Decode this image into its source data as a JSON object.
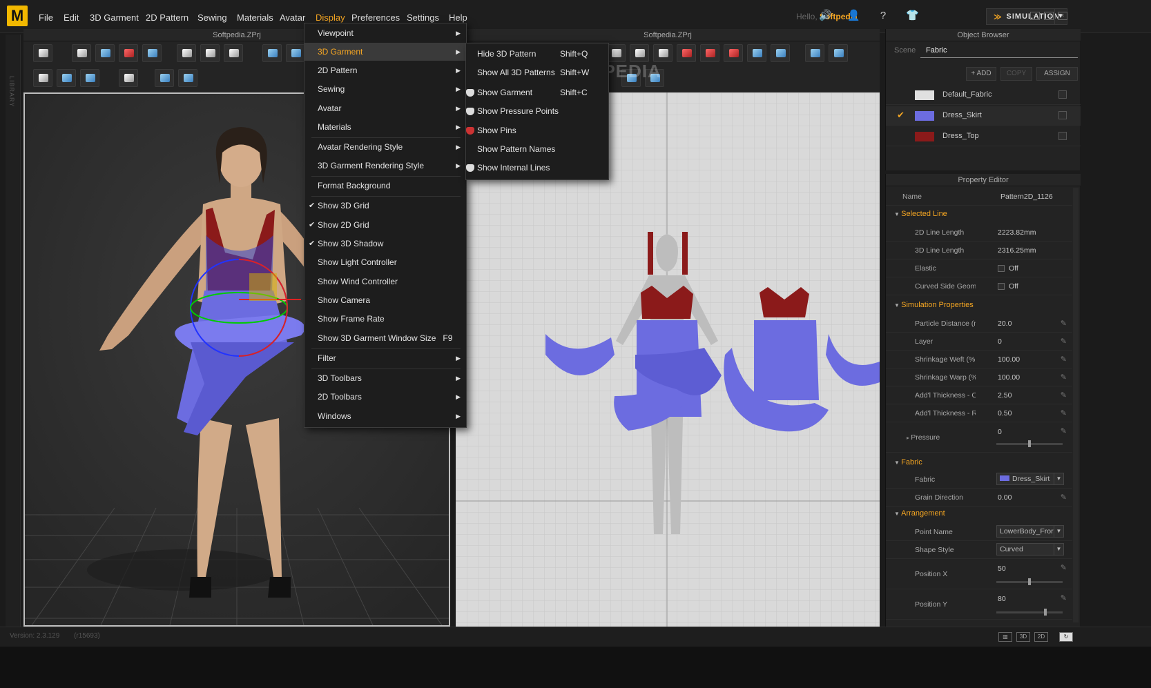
{
  "app": {
    "logo_letter": "M",
    "menus": [
      "File",
      "Edit",
      "3D Garment",
      "2D Pattern",
      "Sewing",
      "Materials",
      "Avatar",
      "Display",
      "Preferences",
      "Settings",
      "Help"
    ],
    "active_menu": "Display",
    "hello_prefix": "Hello,",
    "user": "Softpedia",
    "simulation_label": "SIMULATION",
    "library_label": "LIBRARY"
  },
  "panels": {
    "view3d_title": "Softpedia.ZPrj",
    "view2d_title": "Softpedia.ZPrj",
    "watermark": "SOFTPEDIA"
  },
  "display_menu": {
    "items": [
      {
        "label": "Viewpoint",
        "arrow": "▶"
      },
      {
        "label": "3D Garment",
        "arrow": "▶"
      },
      {
        "label": "2D Pattern",
        "arrow": "▶"
      },
      {
        "label": "Sewing",
        "arrow": "▶"
      },
      {
        "label": "Avatar",
        "arrow": "▶"
      },
      {
        "label": "Materials",
        "arrow": "▶"
      },
      {
        "label": "Avatar Rendering Style",
        "arrow": "▶"
      },
      {
        "label": "3D Garment Rendering Style",
        "arrow": "▶"
      },
      {
        "label": "Format Background"
      },
      {
        "label": "Show 3D Grid",
        "check": "✔"
      },
      {
        "label": "Show 2D Grid",
        "check": "✔"
      },
      {
        "label": "Show 3D Shadow",
        "check": "✔"
      },
      {
        "label": "Show Light Controller"
      },
      {
        "label": "Show Wind Controller"
      },
      {
        "label": "Show Camera"
      },
      {
        "label": "Show Frame Rate"
      },
      {
        "label": "Show 3D Garment Window Size",
        "shortcut": "F9"
      },
      {
        "label": "Filter",
        "arrow": "▶"
      },
      {
        "label": "3D Toolbars",
        "arrow": "▶"
      },
      {
        "label": "2D Toolbars",
        "arrow": "▶"
      },
      {
        "label": "Windows",
        "arrow": "▶"
      }
    ]
  },
  "garment_submenu": {
    "items": [
      {
        "label": "Hide 3D Pattern",
        "shortcut": "Shift+Q"
      },
      {
        "label": "Show All 3D Patterns",
        "shortcut": "Shift+W"
      },
      {
        "label": "Show Garment",
        "shortcut": "Shift+C"
      },
      {
        "label": "Show Pressure Points"
      },
      {
        "label": "Show Pins"
      },
      {
        "label": "Show Pattern Names"
      },
      {
        "label": "Show Internal Lines"
      }
    ]
  },
  "object_browser": {
    "title": "Object Browser",
    "tabs": [
      "Scene",
      "Fabric"
    ],
    "active_tab": "Fabric",
    "add": "+ ADD",
    "copy": "COPY",
    "assign": "ASSIGN",
    "fabrics": [
      {
        "name": "Default_Fabric",
        "color": "#e0e0e0"
      },
      {
        "name": "Dress_Skirt",
        "color": "#6c6ce0",
        "selected": true
      },
      {
        "name": "Dress_Top",
        "color": "#8b1a1a"
      }
    ]
  },
  "property_editor": {
    "title": "Property Editor",
    "name_label": "Name",
    "name_value": "Pattern2D_1126",
    "selected_line": "Selected Line",
    "line_2d_label": "2D Line Length",
    "line_2d_value": "2223.82mm",
    "line_3d_label": "3D Line Length",
    "line_3d_value": "2316.25mm",
    "elastic_label": "Elastic",
    "elastic_value": "Off",
    "curved_label": "Curved Side Geome",
    "curved_value": "Off",
    "sim_props": "Simulation Properties",
    "particle_label": "Particle Distance (m",
    "particle_value": "20.0",
    "layer_label": "Layer",
    "layer_value": "0",
    "weft_label": "Shrinkage Weft (%",
    "weft_value": "100.00",
    "warp_label": "Shrinkage Warp (%",
    "warp_value": "100.00",
    "addcol_label": "Add'l Thickness - Collisio",
    "addcol_value": "2.50",
    "addren_label": "Add'l Thickness - Renderi",
    "addren_value": "0.50",
    "pressure_label": "Pressure",
    "pressure_value": "0",
    "pressure_level": 0.5,
    "fabric_sec": "Fabric",
    "fabric_label": "Fabric",
    "fabric_value": "Dress_Skirt",
    "grain_label": "Grain Direction",
    "grain_value": "0.00",
    "arr_sec": "Arrangement",
    "point_label": "Point Name",
    "point_value": "LowerBody_Fror",
    "shape_label": "Shape Style",
    "shape_value": "Curved",
    "posx_label": "Position X",
    "posx_value": "50",
    "posx_level": 0.5,
    "posy_label": "Position Y",
    "posy_value": "80",
    "posy_level": 0.75
  },
  "status": {
    "version": "Version: 2.3.129",
    "build": "(r15693)",
    "view_buttons": [
      "3D",
      "2D"
    ]
  }
}
